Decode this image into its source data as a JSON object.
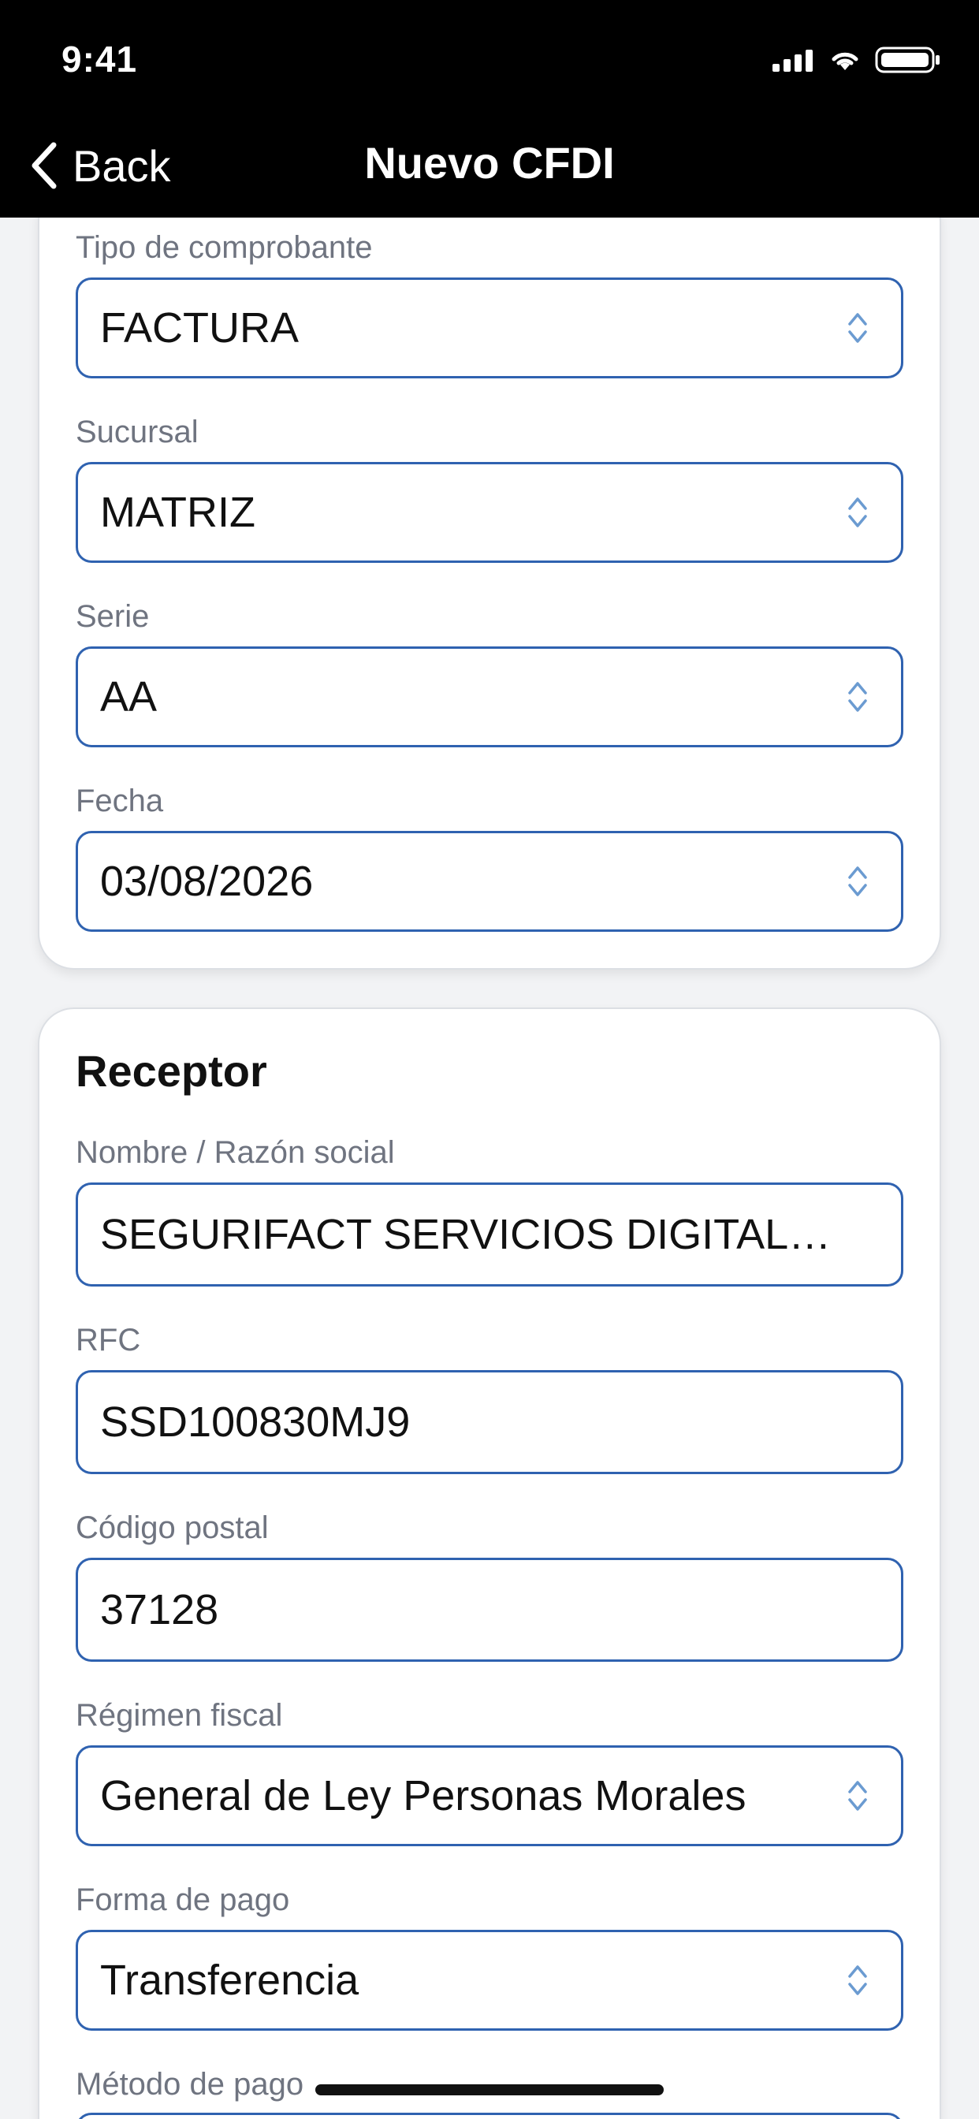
{
  "status_bar": {
    "time": "9:41"
  },
  "nav": {
    "back_label": "Back",
    "title": "Nuevo CFDI"
  },
  "comprobante": {
    "tipo_label": "Tipo de comprobante",
    "tipo_value": "FACTURA",
    "sucursal_label": "Sucursal",
    "sucursal_value": "MATRIZ",
    "serie_label": "Serie",
    "serie_value": "AA",
    "fecha_label": "Fecha",
    "fecha_value": "03/08/2026"
  },
  "receptor": {
    "title": "Receptor",
    "nombre_label": "Nombre / Razón social",
    "nombre_value": "SEGURIFACT SERVICIOS DIGITALES...",
    "rfc_label": "RFC",
    "rfc_value": "SSD100830MJ9",
    "cp_label": "Código postal",
    "cp_value": "37128",
    "regimen_label": "Régimen fiscal",
    "regimen_value": "General de Ley Personas Morales",
    "forma_label": "Forma de pago",
    "forma_value": "Transferencia",
    "metodo_label": "Método de pago"
  },
  "colors": {
    "accent": "#2f62b0",
    "label": "#6f7480",
    "chevron": "#6b9bd1"
  }
}
